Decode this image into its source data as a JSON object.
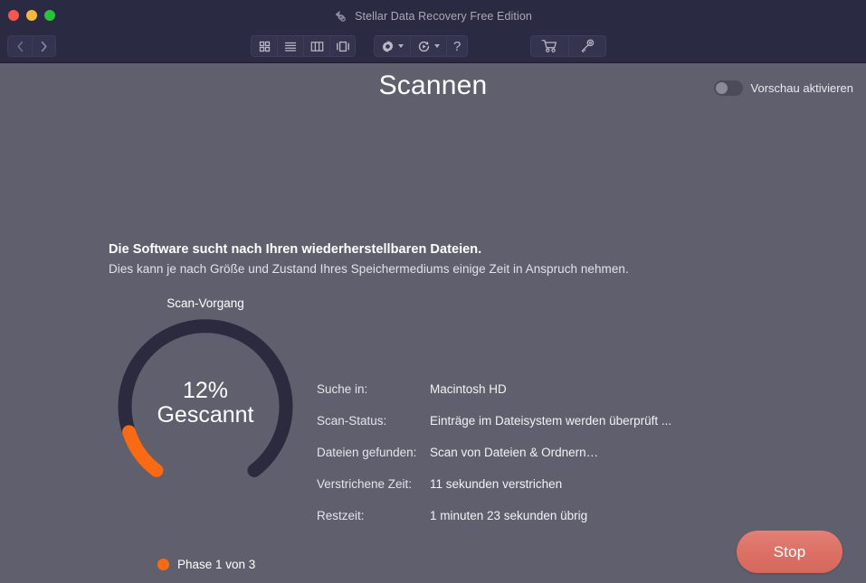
{
  "window": {
    "title": "Stellar Data Recovery Free Edition",
    "app_icon": "recovery-arrow-icon",
    "traffic_lights": {
      "close": "close-window-button",
      "minimize": "minimize-window-button",
      "maximize": "maximize-window-button"
    }
  },
  "toolbar": {
    "nav": [
      {
        "name": "back-button",
        "icon": "chevron-left-icon"
      },
      {
        "name": "forward-button",
        "icon": "chevron-right-icon"
      }
    ],
    "view_modes": [
      {
        "name": "view-icon-grid-button",
        "icon": "grid-view-icon"
      },
      {
        "name": "view-list-button",
        "icon": "list-view-icon"
      },
      {
        "name": "view-column-button",
        "icon": "column-view-icon"
      },
      {
        "name": "view-coverflow-button",
        "icon": "coverflow-view-icon"
      }
    ],
    "actions": [
      {
        "name": "settings-menu-button",
        "icon": "gear-icon",
        "has_caret": true
      },
      {
        "name": "history-menu-button",
        "icon": "clock-rotate-icon",
        "has_caret": true
      },
      {
        "name": "help-button",
        "icon": "question-mark-icon",
        "label": "?"
      }
    ],
    "purchase": [
      {
        "name": "buy-button",
        "icon": "shopping-cart-icon"
      },
      {
        "name": "activate-key-button",
        "icon": "key-icon"
      }
    ]
  },
  "header": {
    "title": "Scannen",
    "preview_toggle_label": "Vorschau aktivieren",
    "preview_toggle_on": false
  },
  "intro": {
    "headline": "Die Software sucht nach Ihren wiederherstellbaren Dateien.",
    "subline": "Dies kann je nach Größe und Zustand Ihres Speichermediums einige Zeit in Anspruch nehmen."
  },
  "gauge": {
    "caption": "Scan-Vorgang",
    "percent_text": "12%",
    "percent_value": 12,
    "status_word": "Gescannt",
    "track_color": "#2b2b40",
    "progress_color": "#f96a14"
  },
  "phase": {
    "text": "Phase 1 von 3",
    "dot_color": "#f96a14"
  },
  "details": [
    {
      "label": "Suche in:",
      "value": "Macintosh HD"
    },
    {
      "label": "Scan-Status:",
      "value": "Einträge im Dateisystem werden überprüft ..."
    },
    {
      "label": "Dateien gefunden:",
      "value": "Scan von Dateien & Ordnern…"
    },
    {
      "label": "Verstrichene Zeit:",
      "value": "11 sekunden verstrichen"
    },
    {
      "label": "Restzeit:",
      "value": "1 minuten 23 sekunden übrig"
    }
  ],
  "footer": {
    "stop_label": "Stop",
    "stop_color": "#dd7166"
  }
}
